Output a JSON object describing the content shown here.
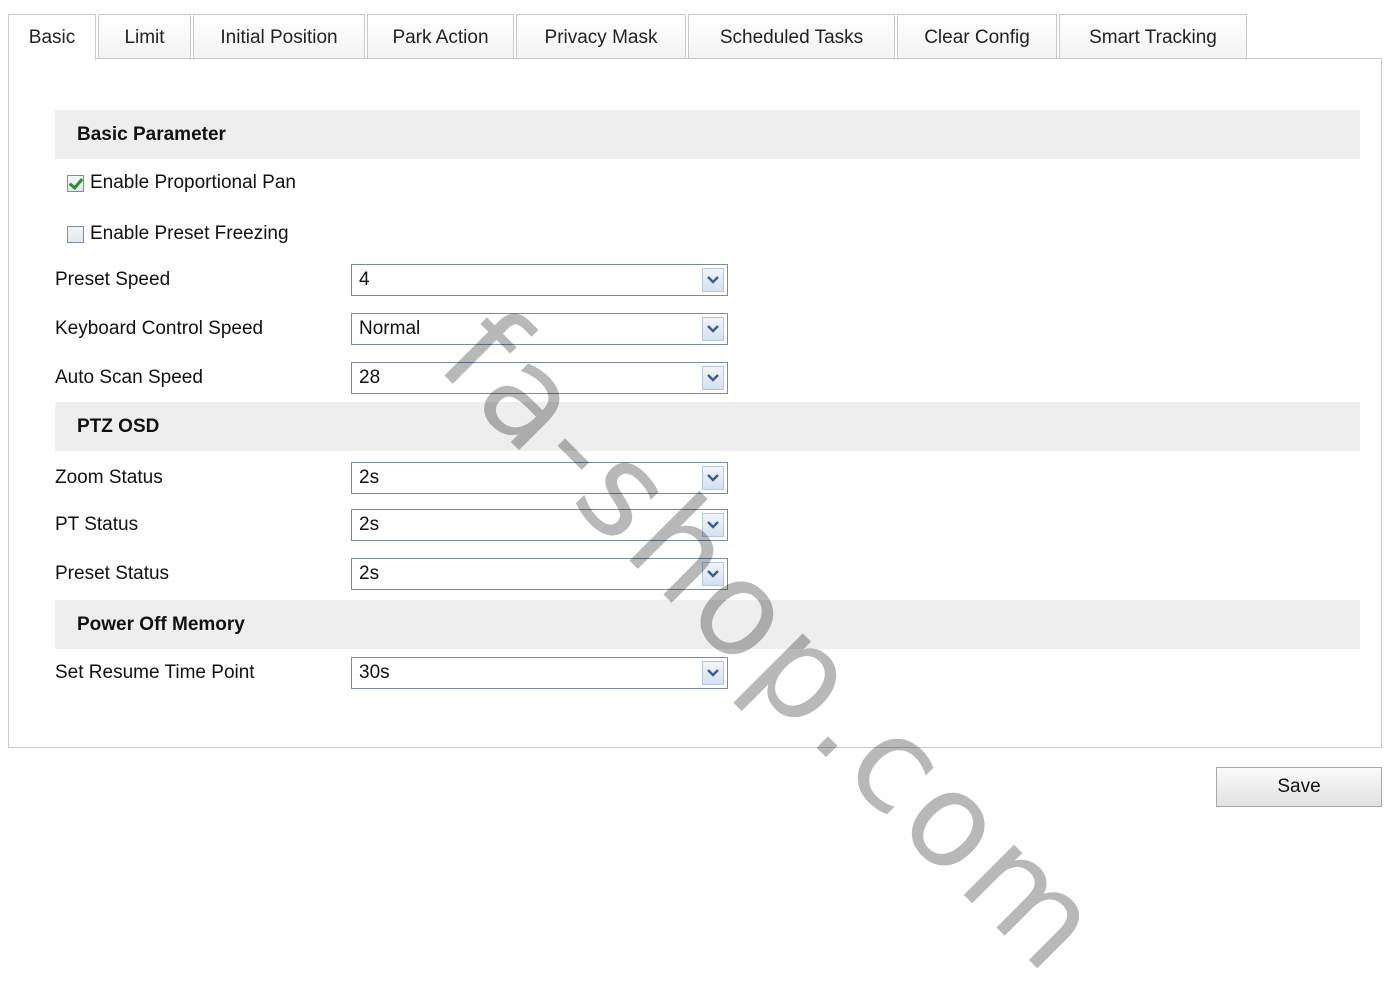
{
  "tabs": [
    {
      "label": "Basic",
      "active": true
    },
    {
      "label": "Limit",
      "active": false
    },
    {
      "label": "Initial Position",
      "active": false
    },
    {
      "label": "Park Action",
      "active": false
    },
    {
      "label": "Privacy Mask",
      "active": false
    },
    {
      "label": "Scheduled Tasks",
      "active": false
    },
    {
      "label": "Clear Config",
      "active": false
    },
    {
      "label": "Smart Tracking",
      "active": false
    }
  ],
  "sections": {
    "basic_parameter": "Basic Parameter",
    "ptz_osd": "PTZ OSD",
    "power_off_memory": "Power Off Memory"
  },
  "checkboxes": {
    "proportional_pan": {
      "label": "Enable Proportional Pan",
      "checked": true
    },
    "preset_freezing": {
      "label": "Enable Preset Freezing",
      "checked": false
    }
  },
  "fields": {
    "preset_speed": {
      "label": "Preset Speed",
      "value": "4"
    },
    "keyboard_control_speed": {
      "label": "Keyboard Control Speed",
      "value": "Normal"
    },
    "auto_scan_speed": {
      "label": "Auto Scan Speed",
      "value": "28"
    },
    "zoom_status": {
      "label": "Zoom Status",
      "value": "2s"
    },
    "pt_status": {
      "label": "PT Status",
      "value": "2s"
    },
    "preset_status": {
      "label": "Preset Status",
      "value": "2s"
    },
    "set_resume_time_point": {
      "label": "Set Resume Time Point",
      "value": "30s"
    }
  },
  "save_label": "Save",
  "watermark": "fa-shop.com",
  "colors": {
    "section_bg": "#eeeeee",
    "check_green": "#2d8a2d",
    "border": "#c9c9c9"
  }
}
